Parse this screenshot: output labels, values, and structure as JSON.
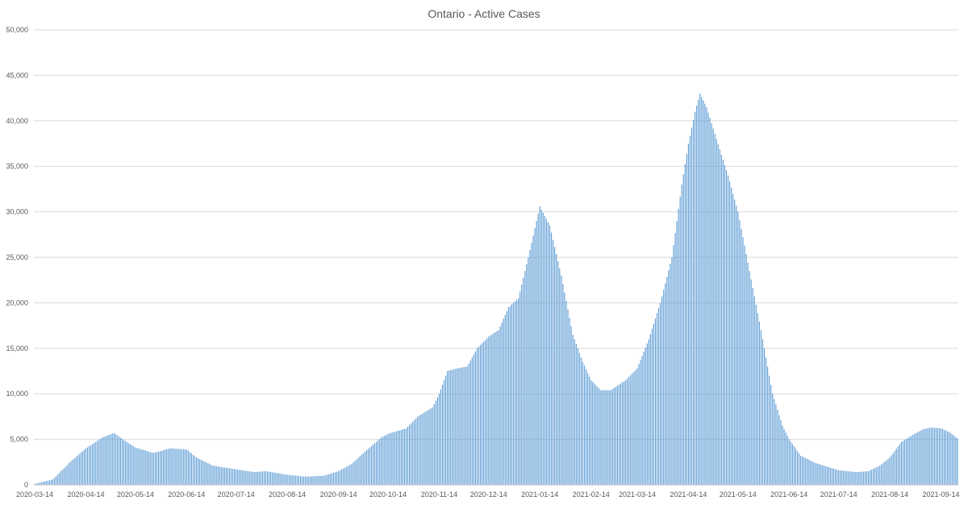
{
  "chart_data": {
    "type": "bar",
    "title": "Ontario - Active Cases",
    "xlabel": "",
    "ylabel": "",
    "ylim": [
      0,
      50000
    ],
    "y_ticks": [
      "0",
      "5,000",
      "10,000",
      "15,000",
      "20,000",
      "25,000",
      "30,000",
      "35,000",
      "40,000",
      "45,000",
      "50,000"
    ],
    "y_tick_values": [
      0,
      5000,
      10000,
      15000,
      20000,
      25000,
      30000,
      35000,
      40000,
      45000,
      50000
    ],
    "x_range": [
      "2020-03-14",
      "2021-09-24"
    ],
    "x_ticks": [
      "2020-03-14",
      "2020-04-14",
      "2020-05-14",
      "2020-06-14",
      "2020-07-14",
      "2020-08-14",
      "2020-09-14",
      "2020-10-14",
      "2020-11-14",
      "2020-12-14",
      "2021-01-14",
      "2021-02-14",
      "2021-03-14",
      "2021-04-14",
      "2021-05-14",
      "2021-06-14",
      "2021-07-14",
      "2021-08-14",
      "2021-09-14"
    ],
    "bar_color": "#5b9bd5",
    "grid": true,
    "legend": "none",
    "key_points": [
      {
        "x": "2020-03-14",
        "y": 100
      },
      {
        "x": "2020-03-25",
        "y": 600
      },
      {
        "x": "2020-04-05",
        "y": 2600
      },
      {
        "x": "2020-04-14",
        "y": 4000
      },
      {
        "x": "2020-04-24",
        "y": 5200
      },
      {
        "x": "2020-05-01",
        "y": 5700
      },
      {
        "x": "2020-05-08",
        "y": 4800
      },
      {
        "x": "2020-05-14",
        "y": 4100
      },
      {
        "x": "2020-05-25",
        "y": 3500
      },
      {
        "x": "2020-06-04",
        "y": 4000
      },
      {
        "x": "2020-06-14",
        "y": 3900
      },
      {
        "x": "2020-06-20",
        "y": 3000
      },
      {
        "x": "2020-06-30",
        "y": 2100
      },
      {
        "x": "2020-07-14",
        "y": 1700
      },
      {
        "x": "2020-07-25",
        "y": 1400
      },
      {
        "x": "2020-08-01",
        "y": 1500
      },
      {
        "x": "2020-08-14",
        "y": 1100
      },
      {
        "x": "2020-08-25",
        "y": 900
      },
      {
        "x": "2020-09-05",
        "y": 1000
      },
      {
        "x": "2020-09-14",
        "y": 1500
      },
      {
        "x": "2020-09-22",
        "y": 2300
      },
      {
        "x": "2020-10-01",
        "y": 3800
      },
      {
        "x": "2020-10-10",
        "y": 5200
      },
      {
        "x": "2020-10-14",
        "y": 5600
      },
      {
        "x": "2020-10-25",
        "y": 6200
      },
      {
        "x": "2020-11-01",
        "y": 7500
      },
      {
        "x": "2020-11-10",
        "y": 8500
      },
      {
        "x": "2020-11-14",
        "y": 10000
      },
      {
        "x": "2020-11-19",
        "y": 12500
      },
      {
        "x": "2020-11-25",
        "y": 12800
      },
      {
        "x": "2020-12-01",
        "y": 13000
      },
      {
        "x": "2020-12-07",
        "y": 15000
      },
      {
        "x": "2020-12-14",
        "y": 16300
      },
      {
        "x": "2020-12-20",
        "y": 17000
      },
      {
        "x": "2020-12-26",
        "y": 19500
      },
      {
        "x": "2021-01-01",
        "y": 20500
      },
      {
        "x": "2021-01-07",
        "y": 25000
      },
      {
        "x": "2021-01-14",
        "y": 30600
      },
      {
        "x": "2021-01-20",
        "y": 28500
      },
      {
        "x": "2021-01-27",
        "y": 23000
      },
      {
        "x": "2021-02-03",
        "y": 16500
      },
      {
        "x": "2021-02-09",
        "y": 13500
      },
      {
        "x": "2021-02-14",
        "y": 11500
      },
      {
        "x": "2021-02-20",
        "y": 10400
      },
      {
        "x": "2021-02-26",
        "y": 10400
      },
      {
        "x": "2021-03-07",
        "y": 11500
      },
      {
        "x": "2021-03-14",
        "y": 12800
      },
      {
        "x": "2021-03-21",
        "y": 16000
      },
      {
        "x": "2021-03-28",
        "y": 20000
      },
      {
        "x": "2021-04-04",
        "y": 25000
      },
      {
        "x": "2021-04-10",
        "y": 33000
      },
      {
        "x": "2021-04-14",
        "y": 37500
      },
      {
        "x": "2021-04-18",
        "y": 41000
      },
      {
        "x": "2021-04-21",
        "y": 43000
      },
      {
        "x": "2021-04-25",
        "y": 41500
      },
      {
        "x": "2021-05-01",
        "y": 38000
      },
      {
        "x": "2021-05-08",
        "y": 34000
      },
      {
        "x": "2021-05-14",
        "y": 30000
      },
      {
        "x": "2021-05-21",
        "y": 23500
      },
      {
        "x": "2021-05-28",
        "y": 17000
      },
      {
        "x": "2021-06-04",
        "y": 10000
      },
      {
        "x": "2021-06-10",
        "y": 6500
      },
      {
        "x": "2021-06-14",
        "y": 5000
      },
      {
        "x": "2021-06-21",
        "y": 3200
      },
      {
        "x": "2021-06-30",
        "y": 2400
      },
      {
        "x": "2021-07-14",
        "y": 1600
      },
      {
        "x": "2021-07-25",
        "y": 1400
      },
      {
        "x": "2021-08-01",
        "y": 1500
      },
      {
        "x": "2021-08-08",
        "y": 2100
      },
      {
        "x": "2021-08-14",
        "y": 3000
      },
      {
        "x": "2021-08-21",
        "y": 4700
      },
      {
        "x": "2021-08-28",
        "y": 5500
      },
      {
        "x": "2021-09-03",
        "y": 6100
      },
      {
        "x": "2021-09-08",
        "y": 6300
      },
      {
        "x": "2021-09-14",
        "y": 6200
      },
      {
        "x": "2021-09-19",
        "y": 5800
      },
      {
        "x": "2021-09-24",
        "y": 5100
      }
    ]
  }
}
